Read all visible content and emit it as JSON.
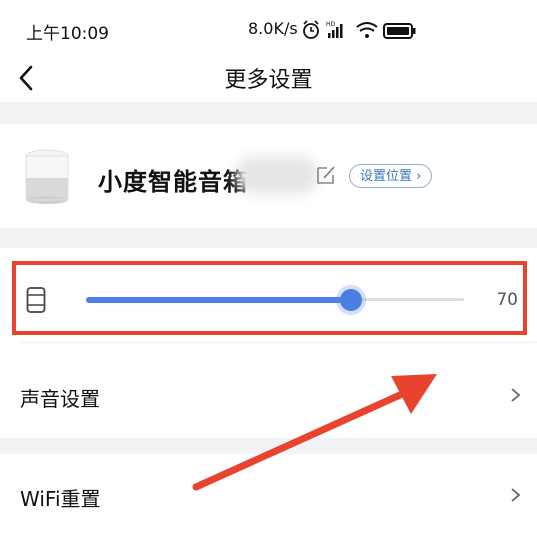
{
  "status_bar": {
    "time": "上午10:09",
    "network": "8.0K/s"
  },
  "header": {
    "title": "更多设置"
  },
  "device": {
    "name": "小度智能音箱",
    "location_button": "设置位置"
  },
  "volume": {
    "value": "70",
    "level_percent": 70
  },
  "menu": [
    {
      "label": "声音设置"
    },
    {
      "label": "WiFi重置"
    }
  ],
  "colors": {
    "accent": "#4f80e1",
    "highlight_box": "#e8432e",
    "arrow": "#e8432e"
  }
}
